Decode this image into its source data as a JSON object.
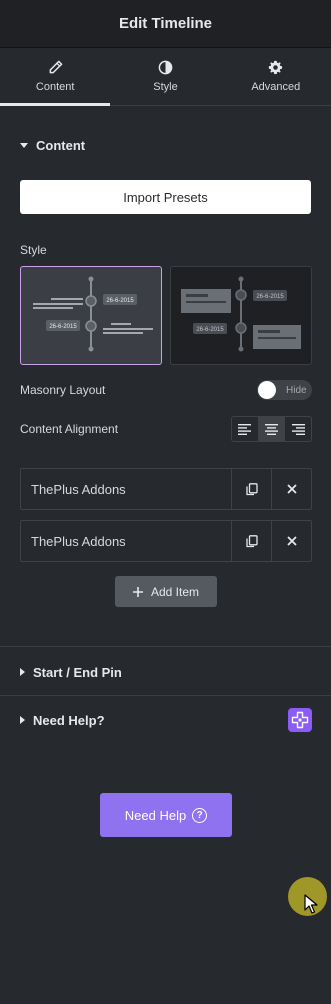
{
  "header": {
    "title": "Edit Timeline"
  },
  "tabs": [
    {
      "label": "Content",
      "icon": "pencil-icon",
      "active": true
    },
    {
      "label": "Style",
      "icon": "contrast-icon",
      "active": false
    },
    {
      "label": "Advanced",
      "icon": "gear-icon",
      "active": false
    }
  ],
  "content_section": {
    "title": "Content",
    "import_button": "Import Presets",
    "style_label": "Style",
    "style_options": [
      {
        "name": "style-1",
        "date1": "26-6-2015",
        "date2": "26-6-2015",
        "selected": true
      },
      {
        "name": "style-2",
        "date1": "26-6-2015",
        "date2": "26-6-2015",
        "selected": false
      }
    ],
    "masonry_label": "Masonry Layout",
    "masonry_toggle": "Hide",
    "alignment_label": "Content Alignment",
    "alignment_options": [
      "left",
      "center",
      "right"
    ],
    "alignment_selected": "center",
    "items": [
      {
        "title": "ThePlus Addons"
      },
      {
        "title": "ThePlus Addons"
      }
    ],
    "add_item_label": "Add Item"
  },
  "start_end_section": {
    "title": "Start / End Pin"
  },
  "need_help_section": {
    "title": "Need Help?",
    "button_label": "Need Help"
  },
  "colors": {
    "background": "#26292d",
    "header_bg": "#1f2124",
    "accent_purple": "#8e72f0",
    "badge_purple": "#8b5cf6",
    "selected_border": "#c9a2e6"
  }
}
